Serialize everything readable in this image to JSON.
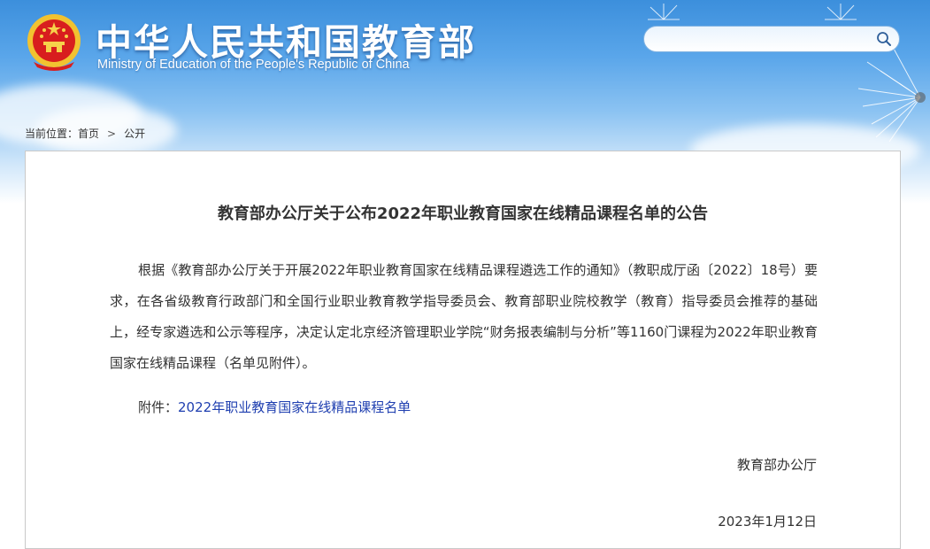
{
  "header": {
    "title_cn": "中华人民共和国教育部",
    "title_en": "Ministry of Education of the People's Republic of China",
    "emblem_icon": "national-emblem-icon",
    "search": {
      "placeholder": "",
      "value": "",
      "icon": "search-icon"
    }
  },
  "breadcrumb": {
    "prefix": "当前位置：",
    "items": [
      "首页",
      "公开"
    ],
    "separator": ">"
  },
  "article": {
    "title": "教育部办公厅关于公布2022年职业教育国家在线精品课程名单的公告",
    "body": "根据《教育部办公厅关于开展2022年职业教育国家在线精品课程遴选工作的通知》（教职成厅函〔2022〕18号）要求，在各省级教育行政部门和全国行业职业教育教学指导委员会、教育部职业院校教学（教育）指导委员会推荐的基础上，经专家遴选和公示等程序，决定认定北京经济管理职业学院“财务报表编制与分析”等1160门课程为2022年职业教育国家在线精品课程（名单见附件）。",
    "attachment_label": "附件：",
    "attachment_link": "2022年职业教育国家在线精品课程名单",
    "signer": "教育部办公厅",
    "date": "2023年1月12日"
  },
  "colors": {
    "sky_top": "#3c8fdc",
    "link": "#1f3fb0",
    "text": "#333333",
    "border": "#c9c9c9"
  }
}
